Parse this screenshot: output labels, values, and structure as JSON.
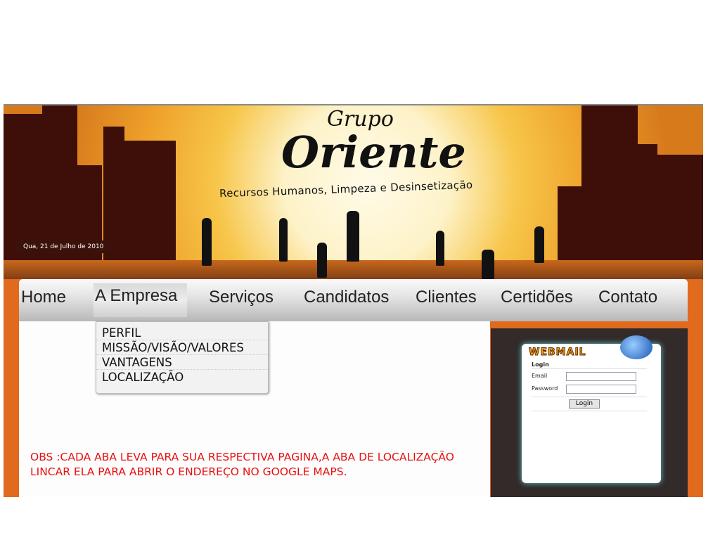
{
  "header": {
    "logo_top": "Grupo",
    "logo_main": "Oriente",
    "tagline": "Recursos Humanos, Limpeza e Desinsetização",
    "date": "Qua, 21 de Julho de 2010"
  },
  "nav": {
    "items": [
      "Home",
      "A Empresa",
      "Serviços",
      "Candidatos",
      "Clientes",
      "Certidões",
      "Contato"
    ],
    "active": "A Empresa"
  },
  "dropdown": {
    "items": [
      "PERFIL",
      "MISSÃO/VISÃO/VALORES",
      "VANTAGENS",
      "LOCALIZAÇÃO"
    ]
  },
  "note": "OBS :CADA ABA LEVA PARA SUA RESPECTIVA PAGINA,A ABA DE LOCALIZAÇÃO LINCAR ELA PARA ABRIR O ENDEREÇO NO GOOGLE MAPS.",
  "webmail": {
    "title": "WEBMAIL",
    "section": "Login",
    "email_label": "Email",
    "password_label": "Password",
    "email_value": "",
    "password_value": "",
    "button": "Login",
    "icon": "globe-mail-icon"
  },
  "colors": {
    "frame": "#e06a1e",
    "building": "#3e0f08",
    "note": "#e81010",
    "webmail_bg": "#332a2a"
  }
}
